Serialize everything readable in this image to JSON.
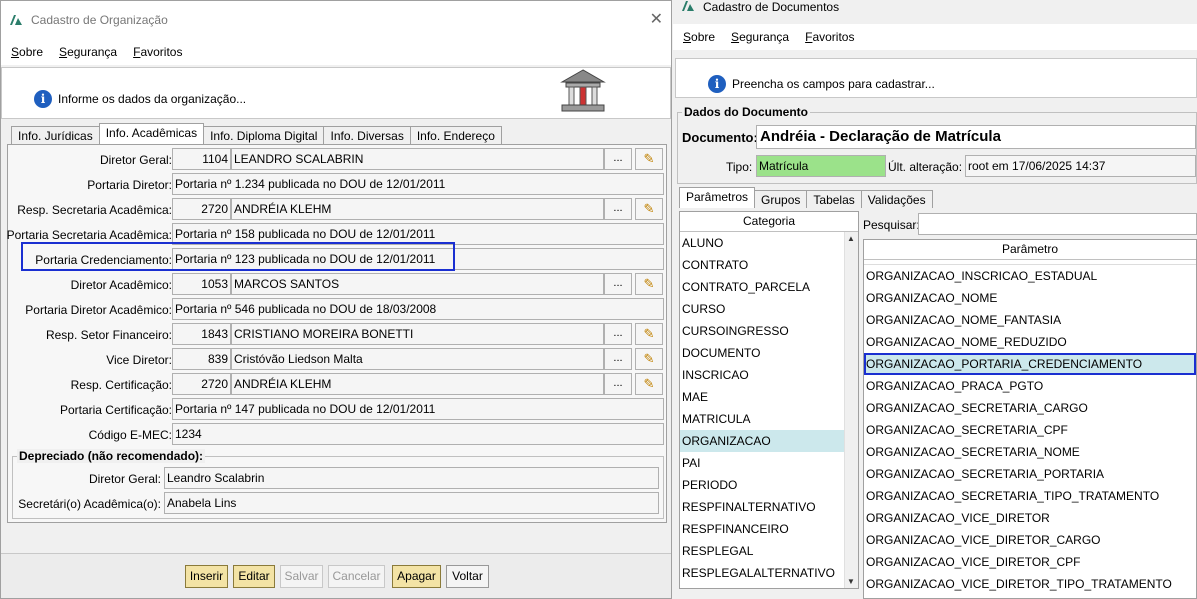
{
  "left": {
    "title": "Cadastro de Organização",
    "menu": [
      "Sobre",
      "Segurança",
      "Favoritos"
    ],
    "info": "Informe os dados da organização...",
    "tabs": [
      "Info. Jurídicas",
      "Info. Acadêmicas",
      "Info. Diploma Digital",
      "Info. Diversas",
      "Info. Endereço"
    ],
    "fields": {
      "diretor_geral": {
        "label": "Diretor Geral:",
        "code": "1104",
        "name": "LEANDRO SCALABRIN"
      },
      "portaria_diretor": {
        "label": "Portaria Diretor:",
        "value": "Portaria nº 1.234 publicada no DOU de 12/01/2011"
      },
      "resp_secretaria": {
        "label": "Resp. Secretaria Acadêmica:",
        "code": "2720",
        "name": "ANDRÉIA KLEHM"
      },
      "portaria_secretaria": {
        "label": "Portaria Secretaria Acadêmica:",
        "value": "Portaria nº 158 publicada no DOU de 12/01/2011"
      },
      "portaria_credenciamento": {
        "label": "Portaria Credenciamento:",
        "value": "Portaria nº 123 publicada no DOU de 12/01/2011"
      },
      "diretor_academico": {
        "label": "Diretor Acadêmico:",
        "code": "1053",
        "name": "MARCOS SANTOS"
      },
      "portaria_diretor_academico": {
        "label": "Portaria Diretor Acadêmico:",
        "value": "Portaria nº 546 publicada no DOU de 18/03/2008"
      },
      "resp_setor_financeiro": {
        "label": "Resp. Setor Financeiro:",
        "code": "1843",
        "name": "CRISTIANO MOREIRA BONETTI"
      },
      "vice_diretor": {
        "label": "Vice Diretor:",
        "code": "839",
        "name": "Cristóvão Liedson Malta"
      },
      "resp_certificacao": {
        "label": "Resp. Certificação:",
        "code": "2720",
        "name": "ANDRÉIA KLEHM"
      },
      "portaria_certificacao": {
        "label": "Portaria Certificação:",
        "value": "Portaria nº 147 publicada no DOU de 12/01/2011"
      },
      "codigo_emec": {
        "label": "Código E-MEC:",
        "value": "1234"
      }
    },
    "depreciado": {
      "title": "Depreciado (não recomendado):",
      "diretor_geral": {
        "label": "Diretor Geral:",
        "value": "Leandro Scalabrin"
      },
      "secretaria": {
        "label": "Secretári(o) Acadêmica(o):",
        "value": "Anabela Lins"
      }
    },
    "buttons": {
      "inserir": "Inserir",
      "editar": "Editar",
      "salvar": "Salvar",
      "cancelar": "Cancelar",
      "apagar": "Apagar",
      "voltar": "Voltar"
    },
    "dots": "...",
    "pencil": "✎"
  },
  "right": {
    "title": "Cadastro de Documentos",
    "menu": [
      "Sobre",
      "Segurança",
      "Favoritos"
    ],
    "info": "Preencha os campos para cadastrar...",
    "group_title": "Dados do Documento",
    "documento_label": "Documento:",
    "documento_value": "Andréia - Declaração de Matrícula",
    "tipo_label": "Tipo:",
    "tipo_value": "Matrícula",
    "ult_label": "Últ. alteração:",
    "ult_value": "root em 17/06/2025 14:37",
    "tabs": [
      "Parâmetros",
      "Grupos",
      "Tabelas",
      "Validações"
    ],
    "categoria_header": "Categoria",
    "categorias": [
      "ALUNO",
      "CONTRATO",
      "CONTRATO_PARCELA",
      "CURSO",
      "CURSOINGRESSO",
      "DOCUMENTO",
      "INSCRICAO",
      "MAE",
      "MATRICULA",
      "ORGANIZACAO",
      "PAI",
      "PERIODO",
      "RESPFINALTERNATIVO",
      "RESPFINANCEIRO",
      "RESPLEGAL",
      "RESPLEGALALTERNATIVO"
    ],
    "categoria_selected": "ORGANIZACAO",
    "pesquisar_label": "Pesquisar:",
    "pesquisar_value": "",
    "parametro_header": "Parâmetro",
    "parametros": [
      "ORGANIZACAO_INSCRICAO_ESTADUAL",
      "ORGANIZACAO_NOME",
      "ORGANIZACAO_NOME_FANTASIA",
      "ORGANIZACAO_NOME_REDUZIDO",
      "ORGANIZACAO_PORTARIA_CREDENCIAMENTO",
      "ORGANIZACAO_PRACA_PGTO",
      "ORGANIZACAO_SECRETARIA_CARGO",
      "ORGANIZACAO_SECRETARIA_CPF",
      "ORGANIZACAO_SECRETARIA_NOME",
      "ORGANIZACAO_SECRETARIA_PORTARIA",
      "ORGANIZACAO_SECRETARIA_TIPO_TRATAMENTO",
      "ORGANIZACAO_VICE_DIRETOR",
      "ORGANIZACAO_VICE_DIRETOR_CARGO",
      "ORGANIZACAO_VICE_DIRETOR_CPF",
      "ORGANIZACAO_VICE_DIRETOR_TIPO_TRATAMENTO"
    ],
    "parametro_selected": "ORGANIZACAO_PORTARIA_CREDENCIAMENTO"
  },
  "colors": {
    "highlight": "#1a2fd1",
    "tipo_bg": "#9be28a",
    "selected_bg": "#cce8ec",
    "button_yellow": "#f3e3a5"
  }
}
